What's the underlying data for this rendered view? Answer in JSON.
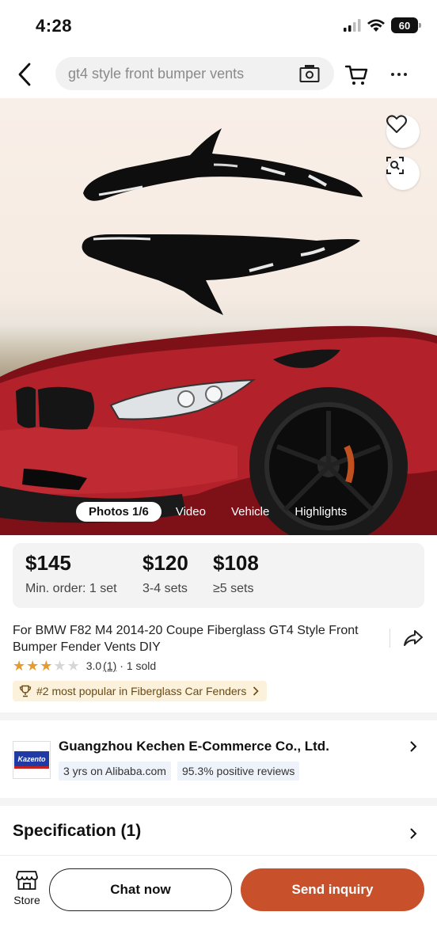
{
  "status_bar": {
    "time": "4:28",
    "battery": "60"
  },
  "nav": {
    "search_text": "gt4 style front bumper vents"
  },
  "media_tabs": [
    {
      "label": "Photos 1/6",
      "active": true
    },
    {
      "label": "Video",
      "active": false
    },
    {
      "label": "Vehicle",
      "active": false
    },
    {
      "label": "Highlights",
      "active": false
    }
  ],
  "pricing": {
    "tiers": [
      {
        "price": "$145",
        "qty": "Min. order: 1 set"
      },
      {
        "price": "$120",
        "qty": "3-4 sets"
      },
      {
        "price": "$108",
        "qty": "≥5 sets"
      }
    ]
  },
  "product": {
    "title": "For BMW F82 M4 2014-20 Coupe Fiberglass GT4 Style Front Bumper Fender Vents DIY",
    "rating": 3.0,
    "rating_text": "3.0",
    "review_count": "(1)",
    "sold_text": "· 1 sold",
    "popular_text": "#2 most popular in Fiberglass Car Fenders"
  },
  "supplier": {
    "name": "Guangzhou Kechen E-Commerce Co., Ltd.",
    "logo_text": "Kazento",
    "tags": [
      "3 yrs on Alibaba.com",
      "95.3% positive reviews"
    ]
  },
  "specification": {
    "title": "Specification (1)"
  },
  "bottom_bar": {
    "store_label": "Store",
    "chat_label": "Chat now",
    "inquiry_label": "Send inquiry"
  },
  "colors": {
    "accent": "#c8502a",
    "star": "#e59b2d",
    "badge_bg": "#fcf2dc",
    "car_red": "#b3212a"
  },
  "icons": [
    "back-icon",
    "camera-icon",
    "cart-icon",
    "more-icon",
    "heart-icon",
    "image-search-icon",
    "share-icon",
    "trophy-icon",
    "chevron-right-icon",
    "store-icon"
  ]
}
